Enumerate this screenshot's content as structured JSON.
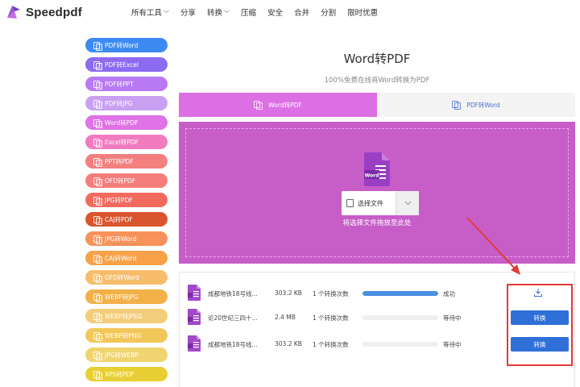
{
  "header": {
    "logo_text": "Speedpdf",
    "nav": [
      {
        "label": "所有工具",
        "has_dropdown": true
      },
      {
        "label": "分享",
        "has_dropdown": false
      },
      {
        "label": "转换",
        "has_dropdown": true
      },
      {
        "label": "压缩",
        "has_dropdown": false
      },
      {
        "label": "安全",
        "has_dropdown": false
      },
      {
        "label": "合并",
        "has_dropdown": false
      },
      {
        "label": "分割",
        "has_dropdown": false
      },
      {
        "label": "限时优惠",
        "has_dropdown": false
      }
    ],
    "caret_glyph": "﹀"
  },
  "sidebar": {
    "items": [
      {
        "label": "PDF转Word",
        "color": "#3d8bf2"
      },
      {
        "label": "PDF转Excel",
        "color": "#8c6bf0"
      },
      {
        "label": "PDF转PPT",
        "color": "#b77af4"
      },
      {
        "label": "PDF转JPG",
        "color": "#c9a0f1"
      },
      {
        "label": "Word转PDF",
        "color": "#de72e6"
      },
      {
        "label": "Excel转PDF",
        "color": "#f27bc0"
      },
      {
        "label": "PPT转PDF",
        "color": "#f2807f"
      },
      {
        "label": "OFD转PDF",
        "color": "#f47d7b"
      },
      {
        "label": "JPG转PDF",
        "color": "#f26a5e"
      },
      {
        "label": "CAJ转PDF",
        "color": "#d9552e"
      },
      {
        "label": "JPG转Word",
        "color": "#f7925a"
      },
      {
        "label": "CAJ转Word",
        "color": "#f7a248"
      },
      {
        "label": "OFD转Word",
        "color": "#f7bd6c"
      },
      {
        "label": "WEBP转JPG",
        "color": "#f2b048"
      },
      {
        "label": "WEBP转JPEG",
        "color": "#f2cd7a"
      },
      {
        "label": "WEBP转PNG",
        "color": "#f2c75a"
      },
      {
        "label": "JPG转WEBP",
        "color": "#f0d470"
      },
      {
        "label": "XPS转PDF",
        "color": "#e8cf34"
      }
    ]
  },
  "main": {
    "title": "Word转PDF",
    "subtitle": "100%免费在线将Word转换为PDF",
    "tabs": [
      {
        "label": "Word转PDF",
        "active": true
      },
      {
        "label": "PDF转Word",
        "active": false
      }
    ],
    "dropzone": {
      "file_icon_label": "Word",
      "select_label": "选择文件",
      "hint": "将选择文件拖放至此处"
    },
    "files": [
      {
        "name": "成都地铁18号线...",
        "size": "303.2 KB",
        "count": "1 个转换次数",
        "progress": 1.0,
        "status": "成功",
        "action": "download"
      },
      {
        "name": "论20世纪三四十...",
        "size": "2.4 MB",
        "count": "1 个转换次数",
        "progress": 0.0,
        "status": "等待中",
        "action": "转换"
      },
      {
        "name": "成都地铁18号线...",
        "size": "303.2 KB",
        "count": "1 个转换次数",
        "progress": 0.0,
        "status": "等待中",
        "action": "转换"
      }
    ]
  },
  "colors": {
    "accent": "#dd6fe4",
    "dropzone": "#c75ec8",
    "button": "#2f6fd8",
    "annotation": "#e23a3a"
  }
}
